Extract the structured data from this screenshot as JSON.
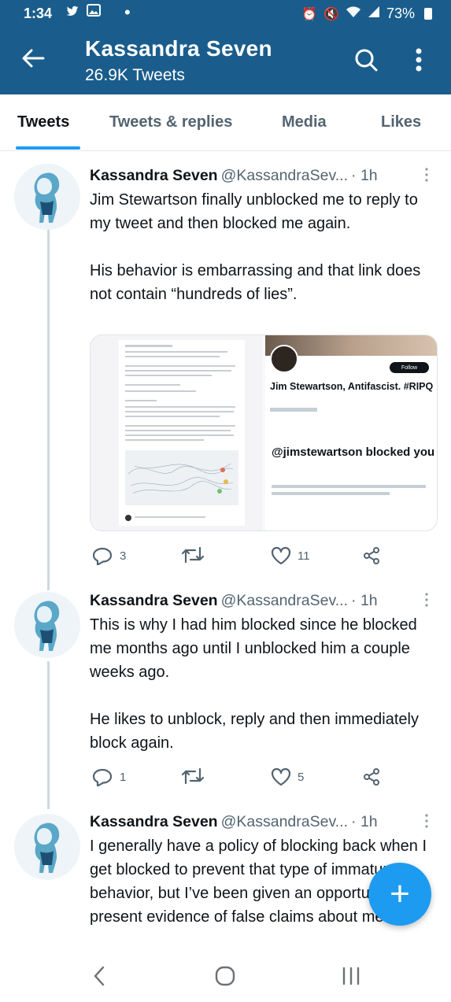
{
  "status_bar": {
    "time": "1:34",
    "battery": "73%",
    "icons": [
      "twitter-icon",
      "gallery-icon",
      "alarm-icon",
      "mute-icon",
      "wifi-icon",
      "signal-icon",
      "battery-icon"
    ]
  },
  "header": {
    "title": "Kassandra Seven",
    "subtitle": "26.9K Tweets"
  },
  "tabs": [
    {
      "label": "Tweets",
      "active": true
    },
    {
      "label": "Tweets & replies",
      "active": false
    },
    {
      "label": "Media",
      "active": false
    },
    {
      "label": "Likes",
      "active": false
    }
  ],
  "tweets": [
    {
      "name": "Kassandra Seven",
      "handle": "@KassandraSev...",
      "time": "· 1h",
      "text": "Jim Stewartson finally unblocked me to reply to my tweet and then blocked me again.\n\nHis behavior is embarrassing and that link does not contain “hundreds of lies”.",
      "replies": "3",
      "retweets": "",
      "likes": "11",
      "media": {
        "profile_name": "Jim Stewartson, Antifascist. #RIPQ",
        "follow_label": "Follow",
        "blocked_title": "@jimstewartson blocked you"
      }
    },
    {
      "name": "Kassandra Seven",
      "handle": "@KassandraSev...",
      "time": "· 1h",
      "text": "This is why I had him blocked since he blocked me months ago until I unblocked him a couple weeks ago.\n\nHe likes to unblock, reply and then immediately block again.",
      "replies": "1",
      "retweets": "",
      "likes": "5"
    },
    {
      "name": "Kassandra Seven",
      "handle": "@KassandraSev...",
      "time": "· 1h",
      "text": "I generally have a policy of blocking back when I get blocked to prevent that type of immature behavior, but I’ve been given an opportunity to present evidence of false claims about me."
    }
  ],
  "colors": {
    "header_bg": "#1a5d8c",
    "accent": "#1d9bf0",
    "text_primary": "#0f1419",
    "text_secondary": "#536471"
  }
}
